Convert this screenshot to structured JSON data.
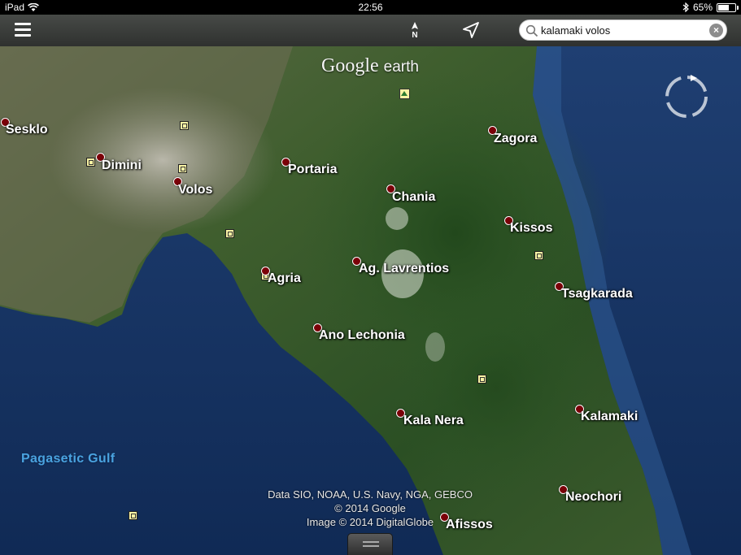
{
  "status_bar": {
    "device": "iPad",
    "time": "22:56",
    "battery_percent": "65%",
    "battery_level": 0.65,
    "icons": [
      "wifi-icon",
      "bluetooth-icon",
      "battery-icon"
    ]
  },
  "toolbar": {
    "menu_icon": "hamburger-menu-icon",
    "compass_label": "N",
    "location_icon": "location-arrow-icon",
    "search": {
      "value": "kalamaki volos",
      "icon": "magnifier-icon",
      "clear_icon": "clear-x-icon"
    }
  },
  "map": {
    "logo": {
      "google": "Google",
      "earth": "earth"
    },
    "places": [
      {
        "label": "Sesklo"
      },
      {
        "label": "Dimini"
      },
      {
        "label": "Volos"
      },
      {
        "label": "Portaria"
      },
      {
        "label": "Zagora"
      },
      {
        "label": "Chania"
      },
      {
        "label": "Kissos"
      },
      {
        "label": "Agria"
      },
      {
        "label": "Ag. Lavrentios"
      },
      {
        "label": "Tsagkarada"
      },
      {
        "label": "Ano Lechonia"
      },
      {
        "label": "Kala Nera"
      },
      {
        "label": "Kalamaki"
      },
      {
        "label": "Neochori"
      },
      {
        "label": "Afissos"
      }
    ],
    "water_label": "Pagasetic Gulf",
    "credits": [
      "Data SIO, NOAA, U.S. Navy, NGA, GEBCO",
      "© 2014 Google",
      "Image © 2014 DigitalGlobe"
    ]
  },
  "colors": {
    "sea": "#14325f",
    "forest": "#2f5a27",
    "place_dot": "#7b0008",
    "poi_fill": "#fbf4a4"
  }
}
